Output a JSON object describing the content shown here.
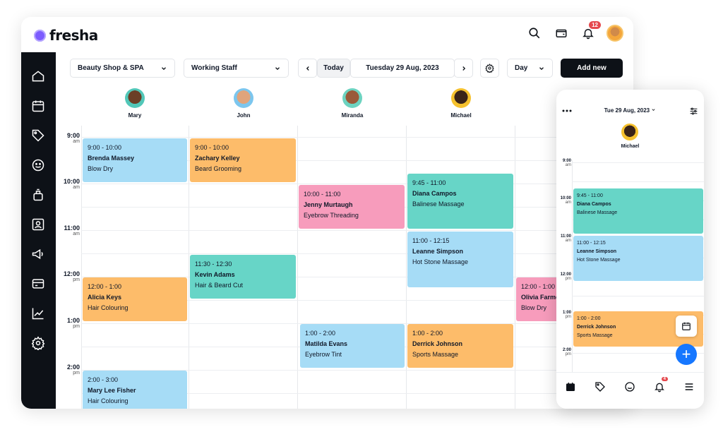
{
  "app": {
    "logo_text": "fresha",
    "accent": "#7c5cff"
  },
  "topbar": {
    "notification_count": "12"
  },
  "toolbar": {
    "location": "Beauty Shop & SPA",
    "staff_filter": "Working Staff",
    "today_label": "Today",
    "date_label": "Tuesday 29 Aug, 2023",
    "view": "Day",
    "add_label": "Add new"
  },
  "staff": [
    {
      "name": "Mary"
    },
    {
      "name": "John"
    },
    {
      "name": "Miranda"
    },
    {
      "name": "Michael"
    }
  ],
  "times": [
    {
      "hour": "9:00",
      "ampm": "am"
    },
    {
      "hour": "10:00",
      "ampm": "am"
    },
    {
      "hour": "11:00",
      "ampm": "am"
    },
    {
      "hour": "12:00",
      "ampm": "pm"
    },
    {
      "hour": "1:00",
      "ampm": "pm"
    },
    {
      "hour": "2:00",
      "ampm": "pm"
    }
  ],
  "appointments": [
    {
      "time": "9:00 - 10:00",
      "client": "Brenda Massey",
      "service": "Blow Dry",
      "color": "#a6dcf6"
    },
    {
      "time": "9:00 - 10:00",
      "client": "Zachary Kelley",
      "service": "Beard Grooming",
      "color": "#fdbc6a"
    },
    {
      "time": "10:00 - 11:00",
      "client": "Jenny Murtaugh",
      "service": "Eyebrow Threading",
      "color": "#f79cbc"
    },
    {
      "time": "9:45 - 11:00",
      "client": "Diana Campos",
      "service": "Balinese Massage",
      "color": "#67d5c7"
    },
    {
      "time": "11:00 - 12:15",
      "client": "Leanne Simpson",
      "service": "Hot Stone Massage",
      "color": "#a6dcf6"
    },
    {
      "time": "11:30 - 12:30",
      "client": "Kevin Adams",
      "service": "Hair & Beard Cut",
      "color": "#67d5c7"
    },
    {
      "time": "12:00 - 1:00",
      "client": "Alicia Keys",
      "service": "Hair Colouring",
      "color": "#fdbc6a"
    },
    {
      "time": "12:00 - 1:00",
      "client": "Olivia Farme",
      "service": "Blow Dry",
      "color": "#f79cbc"
    },
    {
      "time": "1:00 - 2:00",
      "client": "Matilda Evans",
      "service": "Eyebrow Tint",
      "color": "#a6dcf6"
    },
    {
      "time": "1:00 - 2:00",
      "client": "Derrick Johnson",
      "service": "Sports Massage",
      "color": "#fdbc6a"
    },
    {
      "time": "2:00 - 3:00",
      "client": "Mary Lee Fisher",
      "service": "Hair Colouring",
      "color": "#a6dcf6"
    }
  ],
  "phone": {
    "date_label": "Tue 29 Aug, 2023",
    "staff_name": "Michael",
    "badge_count": "4",
    "times": [
      {
        "hour": "9:00",
        "ampm": "am"
      },
      {
        "hour": "10:00",
        "ampm": "am"
      },
      {
        "hour": "11:00",
        "ampm": "am"
      },
      {
        "hour": "12:00",
        "ampm": "pm"
      },
      {
        "hour": "1:00",
        "ampm": "pm"
      },
      {
        "hour": "2:00",
        "ampm": "pm"
      }
    ],
    "appointments": [
      {
        "time": "9:45 - 11:00",
        "client": "Diana Campos",
        "service": "Balinese Massage"
      },
      {
        "time": "11:00 - 12:15",
        "client": "Leanne Simpson",
        "service": "Hot Stone Massage"
      },
      {
        "time": "1:00 - 2:00",
        "client": "Derrick Johnson",
        "service": "Sports Massage"
      }
    ],
    "fab_label": "+"
  }
}
